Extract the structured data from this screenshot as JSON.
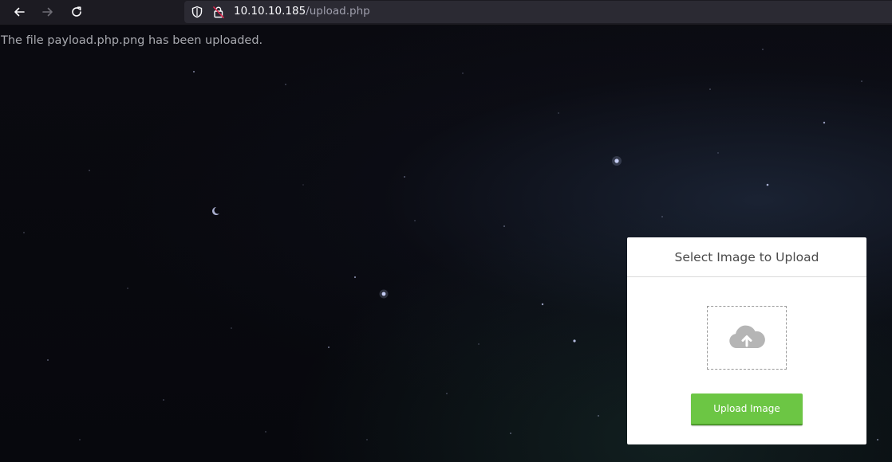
{
  "browser": {
    "url_host": "10.10.10.185",
    "url_path": "/upload.php",
    "back_icon": "arrow-left-icon",
    "forward_icon": "arrow-right-icon",
    "reload_icon": "reload-icon",
    "shield_icon": "tracking-protection-shield-icon",
    "lock_icon": "insecure-lock-icon"
  },
  "page": {
    "status_message": "The file payload.php.png has been uploaded."
  },
  "upload_card": {
    "title": "Select Image to Upload",
    "dropzone_icon": "cloud-upload-icon",
    "button_label": "Upload Image",
    "button_color": "#6cc644"
  }
}
